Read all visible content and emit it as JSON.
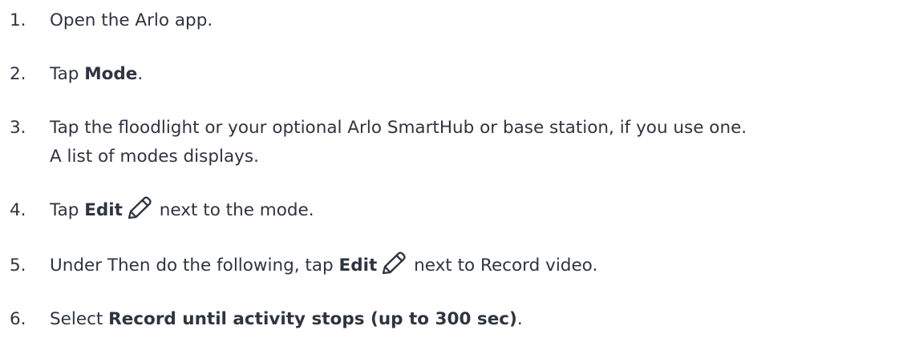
{
  "colors": {
    "text": "#2e3440",
    "icon": "#2e3440",
    "background": "#ffffff"
  },
  "steps": [
    {
      "number": "1.",
      "text": "Open the Arlo app."
    },
    {
      "number": "2.",
      "pre": "Tap ",
      "bold": "Mode",
      "post": "."
    },
    {
      "number": "3.",
      "line1": "Tap the floodlight or your optional Arlo SmartHub or base station, if you use one.",
      "line2": "A list of modes displays."
    },
    {
      "number": "4.",
      "pre": "Tap ",
      "bold": "Edit",
      "icon": "pencil-icon",
      "post": " next to the mode."
    },
    {
      "number": "5.",
      "pre": "Under Then do the following, tap ",
      "bold": "Edit",
      "icon": "pencil-icon",
      "post": " next to Record video."
    },
    {
      "number": "6.",
      "pre": "Select ",
      "bold": "Record until activity stops (up to 300 sec)",
      "post": "."
    }
  ]
}
